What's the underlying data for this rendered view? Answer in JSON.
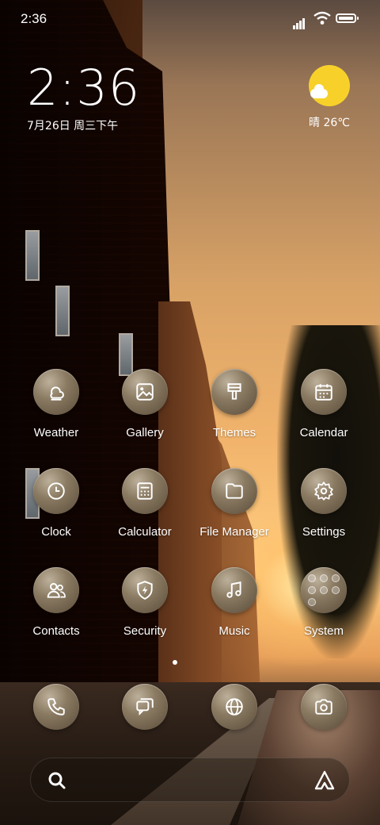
{
  "status_bar": {
    "time": "2:36"
  },
  "clock_widget": {
    "time": "2:36",
    "date": "7月26日 周三下午"
  },
  "weather_widget": {
    "text": "晴 26℃",
    "icon": "sunny-partly-cloudy-icon",
    "sun_color": "#f7d12a"
  },
  "apps": [
    {
      "label": "Weather",
      "icon": "weather-icon"
    },
    {
      "label": "Gallery",
      "icon": "gallery-icon"
    },
    {
      "label": "Themes",
      "icon": "paintbrush-icon"
    },
    {
      "label": "Calendar",
      "icon": "calendar-icon"
    },
    {
      "label": "Clock",
      "icon": "clock-icon"
    },
    {
      "label": "Calculator",
      "icon": "calculator-icon"
    },
    {
      "label": "File Manager",
      "icon": "folder-icon"
    },
    {
      "label": "Settings",
      "icon": "gear-icon"
    },
    {
      "label": "Contacts",
      "icon": "contacts-icon"
    },
    {
      "label": "Security",
      "icon": "shield-icon"
    },
    {
      "label": "Music",
      "icon": "music-note-icon"
    },
    {
      "label": "System",
      "icon": "app-folder-icon"
    }
  ],
  "dock": [
    {
      "icon": "phone-icon"
    },
    {
      "icon": "messages-icon"
    },
    {
      "icon": "browser-icon"
    },
    {
      "icon": "camera-icon"
    }
  ],
  "search_bar": {
    "left_icon": "search-icon",
    "right_icon": "assistant-icon"
  },
  "page_indicator": {
    "pages": 1,
    "current": 1
  }
}
